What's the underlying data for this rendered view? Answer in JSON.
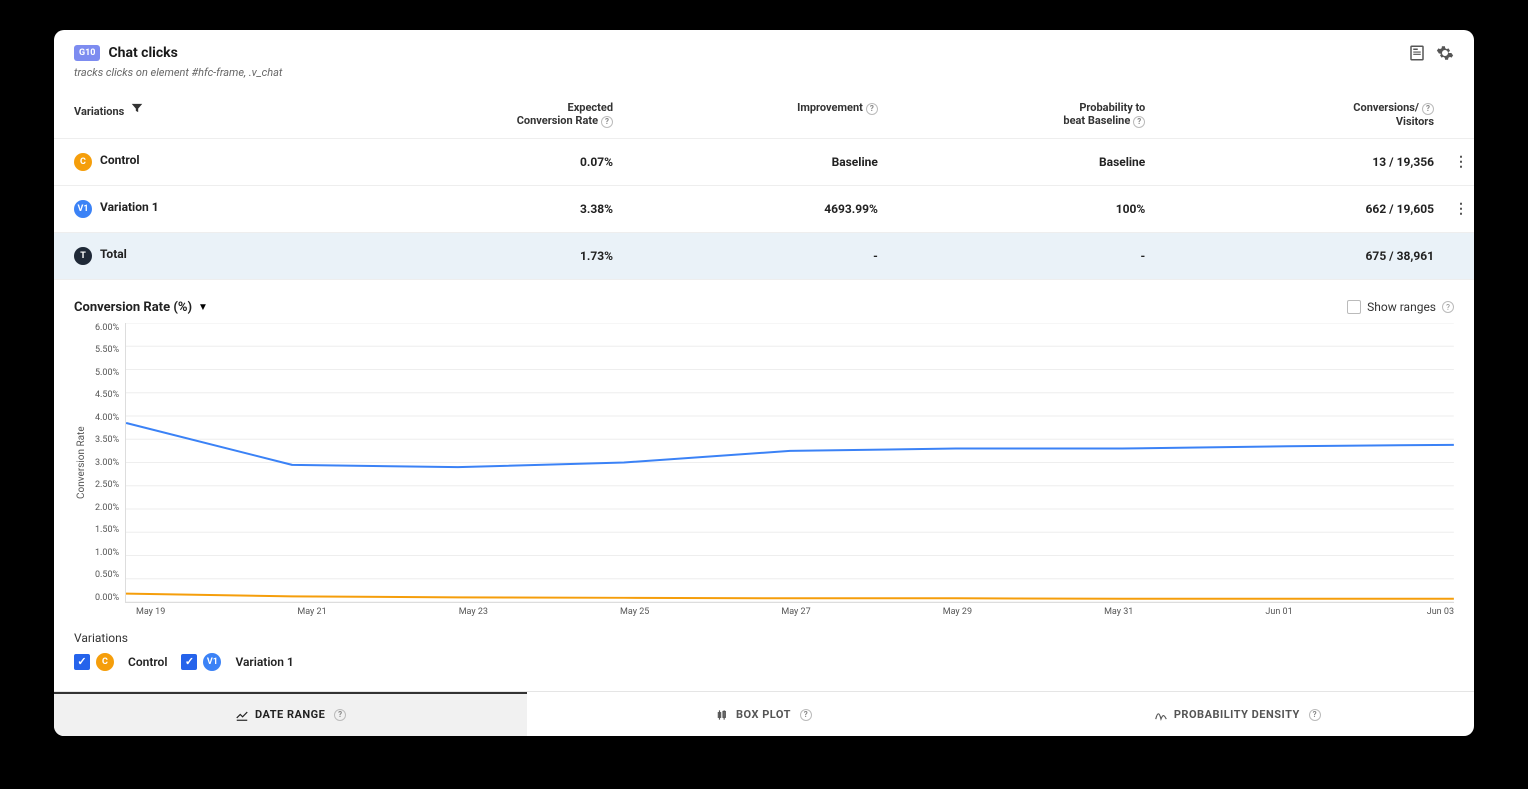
{
  "header": {
    "badge": "G10",
    "title": "Chat clicks",
    "subtitle": "tracks clicks on element #hfc-frame, .v_chat"
  },
  "columns": {
    "variations": "Variations",
    "expected1": "Expected",
    "expected2": "Conversion Rate",
    "improvement": "Improvement",
    "prob1": "Probability to",
    "prob2": "beat Baseline",
    "conv1": "Conversions/",
    "conv2": "Visitors"
  },
  "rows": [
    {
      "chip": "C",
      "chipClass": "chip-c",
      "name": "Control",
      "rate": "0.07%",
      "improve": "Baseline",
      "improveClass": "muted",
      "prob": "Baseline",
      "probClass": "muted",
      "conv": "13 / 19,356",
      "kebab": true
    },
    {
      "chip": "V1",
      "chipClass": "chip-v",
      "name": "Variation 1",
      "rate": "3.38%",
      "improve": "4693.99%",
      "improveClass": "green",
      "prob": "100%",
      "probClass": "",
      "conv": "662 / 19,605",
      "kebab": true
    },
    {
      "chip": "T",
      "chipClass": "chip-t",
      "name": "Total",
      "rate": "1.73%",
      "improve": "-",
      "improveClass": "muted",
      "prob": "-",
      "probClass": "muted",
      "conv": "675 / 38,961",
      "kebab": false,
      "rowClass": "row-total"
    }
  ],
  "chart_section": {
    "title": "Conversion Rate (%)",
    "show_ranges": "Show ranges",
    "legend_title": "Variations",
    "legend": [
      {
        "chip": "C",
        "chipClass": "chip-c",
        "name": "Control"
      },
      {
        "chip": "V1",
        "chipClass": "chip-v",
        "name": "Variation 1"
      }
    ]
  },
  "tabs": {
    "date_range": "DATE RANGE",
    "box_plot": "BOX PLOT",
    "prob_density": "PROBABILITY DENSITY"
  },
  "chart_data": {
    "type": "line",
    "title": "Conversion Rate (%)",
    "xlabel": "",
    "ylabel": "Conversion Rate",
    "ylim": [
      0,
      6.0
    ],
    "yticks": [
      "6.00%",
      "5.50%",
      "5.00%",
      "4.50%",
      "4.00%",
      "3.50%",
      "3.00%",
      "2.50%",
      "2.00%",
      "1.50%",
      "1.00%",
      "0.50%",
      "0.00%"
    ],
    "x": [
      "May 19",
      "May 21",
      "May 23",
      "May 25",
      "May 27",
      "May 29",
      "May 31",
      "Jun 01",
      "Jun 03"
    ],
    "series": [
      {
        "name": "Variation 1",
        "color": "#3b82f6",
        "values": [
          3.85,
          2.95,
          2.9,
          3.0,
          3.25,
          3.3,
          3.3,
          3.35,
          3.38
        ]
      },
      {
        "name": "Control",
        "color": "#f59e0b",
        "values": [
          0.18,
          0.12,
          0.1,
          0.09,
          0.08,
          0.08,
          0.07,
          0.07,
          0.07
        ]
      }
    ]
  }
}
